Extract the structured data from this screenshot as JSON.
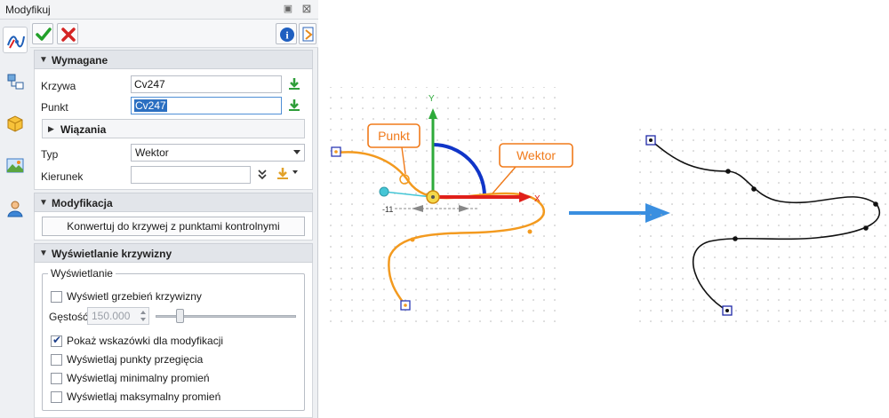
{
  "panel": {
    "title": "Modyfikuj",
    "pin_icon": "pin-icon",
    "close_icon": "close-icon"
  },
  "side_tabs": [
    {
      "icon": "curve-modify-icon",
      "active": true
    },
    {
      "icon": "tree-structure-icon",
      "active": false
    },
    {
      "icon": "box-part-icon",
      "active": false
    },
    {
      "icon": "render-image-icon",
      "active": false
    },
    {
      "icon": "user-icon",
      "active": false
    }
  ],
  "toolbar": {
    "ok_icon": "checkmark-icon",
    "cancel_icon": "cross-icon",
    "info_icon": "info-icon",
    "help_icon": "help-book-icon"
  },
  "required": {
    "title": "Wymagane",
    "curve_label": "Krzywa",
    "curve_value": "Cv247",
    "point_label": "Punkt",
    "point_value": "Cv247",
    "constraints_title": "Wiązania",
    "type_label": "Typ",
    "type_value": "Wektor",
    "direction_label": "Kierunek",
    "direction_value": ""
  },
  "modification": {
    "title": "Modyfikacja",
    "convert_button": "Konwertuj do krzywej z punktami kontrolnymi"
  },
  "display": {
    "title": "Wyświetlanie krzywizny",
    "group_label": "Wyświetlanie",
    "comb_label": "Wyświetl grzebień krzywizny",
    "comb_checked": false,
    "density_label": "Gęstość",
    "density_value": "150.000",
    "density_slider_fraction": 0.17,
    "hints_label": "Pokaż wskazówki dla modyfikacji",
    "hints_checked": true,
    "inflection_label": "Wyświetlaj punkty przegięcia",
    "inflection_checked": false,
    "min_radius_label": "Wyświetlaj minimalny promień",
    "min_radius_checked": false,
    "max_radius_label": "Wyświetlaj maksymalny promień",
    "max_radius_checked": false
  },
  "illustration": {
    "callout_point": "Punkt",
    "callout_vector": "Wektor",
    "axis_y": "Y",
    "axis_x": "X",
    "dim_value": "-11",
    "colors": {
      "curve_before": "#f39a1f",
      "curve_after": "#111111",
      "axis_y": "#2eaa3a",
      "axis_x": "#e0201a",
      "arc": "#1035c8",
      "arrow": "#3a8fe0",
      "callout": "#f07a1a"
    }
  }
}
